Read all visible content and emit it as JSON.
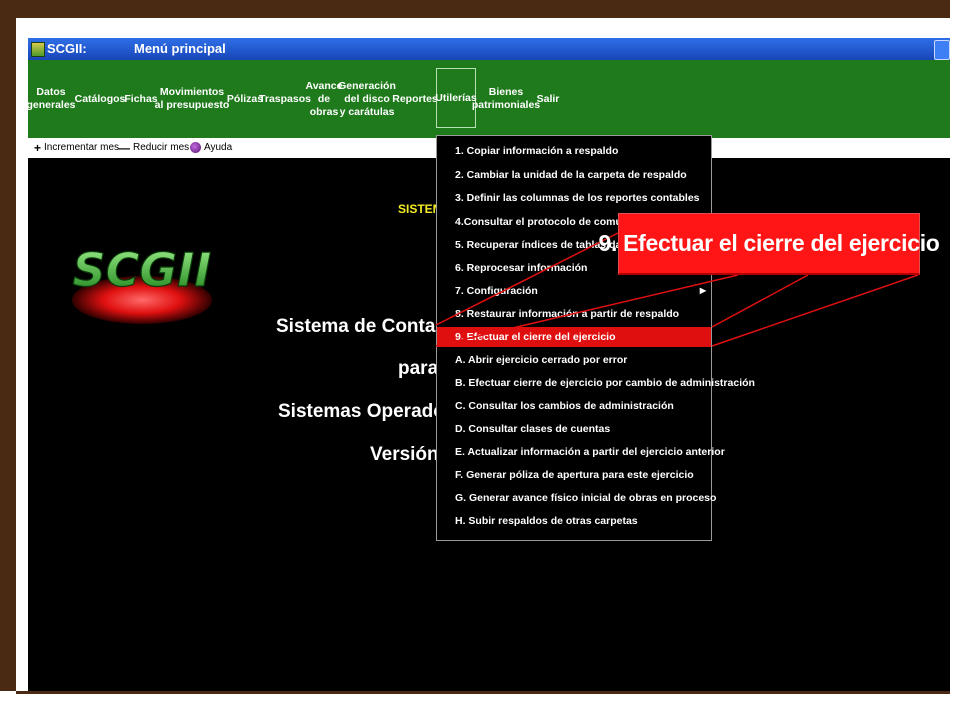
{
  "titlebar": {
    "app": "SCGII:",
    "window": "Menú principal"
  },
  "menubar": [
    {
      "label": "Datos\ngenerales"
    },
    {
      "label": "Catálogos"
    },
    {
      "label": "Fichas"
    },
    {
      "label": "Movimientos\nal presupuesto"
    },
    {
      "label": "Pólizas"
    },
    {
      "label": "Traspasos"
    },
    {
      "label": "Avance\nde\nobras"
    },
    {
      "label": "Generación\ndel disco\ny carátulas"
    },
    {
      "label": "Reportes"
    },
    {
      "label": "Utilerías"
    },
    {
      "label": "Bienes\npatrimoniales"
    },
    {
      "label": "Salir"
    }
  ],
  "toolbar": {
    "increment": "Incrementar mes",
    "reduce": "Reducir mes",
    "help": "Ayuda"
  },
  "content": {
    "sistem_partial": "SISTEM",
    "line1": "Sistema de Contabilida",
    "line2": "para",
    "line3": "Sistemas Operadores",
    "line4": "Versión 2",
    "logo": "SCGII"
  },
  "dropdown": [
    {
      "label": "1. Copiar información a respaldo"
    },
    {
      "label": "2. Cambiar la unidad de la carpeta de respaldo"
    },
    {
      "label": "3. Definir las columnas de los reportes contables"
    },
    {
      "label": "4.Consultar el protocolo de comunicació"
    },
    {
      "label": "5. Recuperar índices de tablas dañados"
    },
    {
      "label": "6. Reprocesar información"
    },
    {
      "label": "7. Configuración",
      "submenu": true
    },
    {
      "label": "8. Restaurar información a partir de respaldo"
    },
    {
      "label": "9. Efectuar el cierre del ejercicio",
      "highlighted": true
    },
    {
      "label": "A. Abrir ejercicio cerrado por error"
    },
    {
      "label": "B. Efectuar cierre de ejercicio por cambio de administración"
    },
    {
      "label": "C. Consultar los cambios de administración"
    },
    {
      "label": "D. Consultar clases de cuentas"
    },
    {
      "label": "E. Actualizar información a partir del ejercicio anterior"
    },
    {
      "label": "F. Generar póliza de apertura para este ejercicio"
    },
    {
      "label": "G. Generar avance físico inicial de obras en proceso"
    },
    {
      "label": "H. Subir respaldos de otras carpetas"
    }
  ],
  "callout": {
    "text": "9. Efectuar el cierre del ejercicio"
  },
  "colors": {
    "frame": "#4a2a12",
    "menubar": "#1f7a1c",
    "titlebar": "#1746b8",
    "highlight": "#e00f0f",
    "callout": "#ff1515",
    "yellow_text": "#f2ea24"
  }
}
